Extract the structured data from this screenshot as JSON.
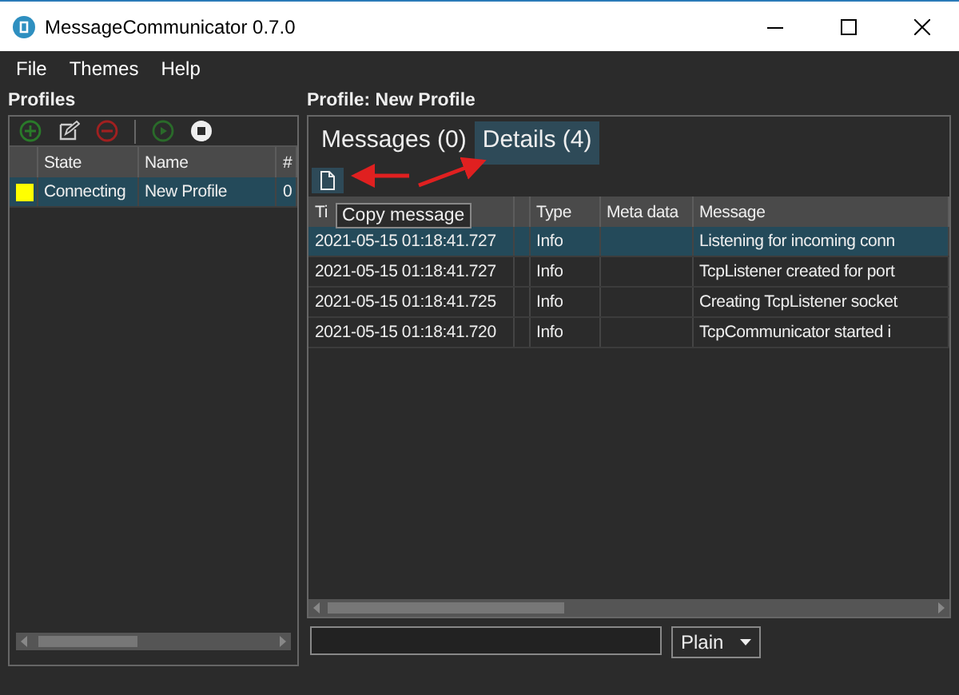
{
  "window": {
    "title": "MessageCommunicator 0.7.0"
  },
  "menu": [
    "File",
    "Themes",
    "Help"
  ],
  "profiles": {
    "title": "Profiles",
    "columns": [
      "State",
      "Name",
      "#"
    ],
    "rows": [
      {
        "state": "Connecting",
        "name": "New Profile",
        "count": "0",
        "color": "#ffff00",
        "selected": true
      }
    ]
  },
  "profile": {
    "title": "Profile: New Profile",
    "tabs": [
      {
        "label": "Messages (0)",
        "selected": false
      },
      {
        "label": "Details (4)",
        "selected": true
      }
    ],
    "tooltip": "Copy message",
    "columns": [
      "Ti",
      "",
      "Type",
      "Meta data",
      "Message"
    ],
    "rows": [
      {
        "time": "2021-05-15 01:18:41.727",
        "type": "Info",
        "meta": "",
        "message": "Listening for incoming conn",
        "selected": true
      },
      {
        "time": "2021-05-15 01:18:41.727",
        "type": "Info",
        "meta": "",
        "message": "TcpListener created for port",
        "selected": false
      },
      {
        "time": "2021-05-15 01:18:41.725",
        "type": "Info",
        "meta": "",
        "message": "Creating TcpListener socket",
        "selected": false
      },
      {
        "time": "2021-05-15 01:18:41.720",
        "type": "Info",
        "meta": "",
        "message": "TcpCommunicator started i",
        "selected": false
      }
    ],
    "format": "Plain"
  }
}
